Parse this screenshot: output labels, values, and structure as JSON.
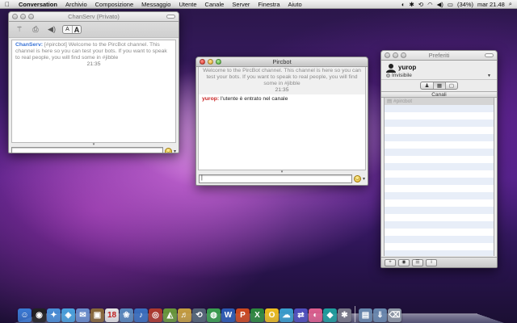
{
  "menubar": {
    "app_name": "Conversation",
    "items": [
      "Archivio",
      "Composizione",
      "Messaggio",
      "Utente",
      "Canale",
      "Server",
      "Finestra",
      "Aiuto"
    ],
    "battery": "(34%)",
    "clock": "mar 21.48"
  },
  "chanserv_window": {
    "title": "ChanServ (Privato)",
    "nick": "ChanServ:",
    "message": "[#pircbot] Welcome to the PircBot channel. This channel is here so you can test your bots. If you want to speak to real people, you will find some in #jibble",
    "timestamp": "21:35",
    "font_small": "A",
    "font_large": "A"
  },
  "pircbot_window": {
    "title": "Pircbot",
    "topic": "Welcome to the PircBot channel. This channel is here so you can test your bots. If you want to speak to real people, you will find some in #jibble",
    "timestamp": "21:35",
    "nick": "yurop:",
    "message": "l'utente è entrato nel canale"
  },
  "preferiti_window": {
    "title": "Preferiti",
    "username": "yurop",
    "status": "Invisibile",
    "list_header": "Canali",
    "channels": [
      "#pircbot"
    ]
  },
  "dock": {
    "icons": [
      "finder",
      "dashboard",
      "safari",
      "ichat",
      "mail",
      "photos",
      "ical",
      "iphoto",
      "itunes",
      "photobooth",
      "preview",
      "garageband",
      "timemachine",
      "chrome",
      "word",
      "powerpoint",
      "excel",
      "skype",
      "weather",
      "sync",
      "colors",
      "ipod",
      "compass",
      "folder",
      "downloads",
      "trash"
    ],
    "icon_colors": [
      "#3a7bd5",
      "#222222",
      "#4a90d9",
      "#4aa3df",
      "#6a8fcf",
      "#8a6a3a",
      "#e8e8e8",
      "#5a8abf",
      "#3a70c0",
      "#b03a2e",
      "#6a9a3a",
      "#c8a040",
      "#556677",
      "#3aa050",
      "#2b5bb5",
      "#d04a20",
      "#2e8a3e",
      "#f0c020",
      "#3aa0d0",
      "#5050c0",
      "#e06090",
      "#20a0a0",
      "#7a7a8a",
      "#6a8ab0",
      "#6a8ab0",
      "#909aa8"
    ],
    "icon_glyphs": [
      "☺",
      "◉",
      "✦",
      "◈",
      "✉",
      "▣",
      "18",
      "❀",
      "♪",
      "◎",
      "◭",
      "♬",
      "⟲",
      "◍",
      "W",
      "P",
      "X",
      "O",
      "☁",
      "⇄",
      "◐",
      "◆",
      "✱",
      "▤",
      "⇓",
      "⌫"
    ]
  }
}
